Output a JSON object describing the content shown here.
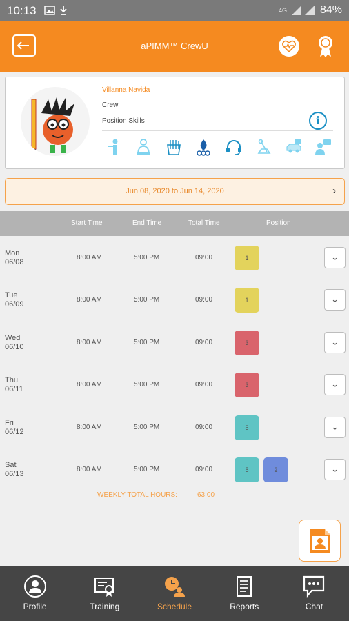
{
  "status_bar": {
    "time": "10:13",
    "network": "4G",
    "battery": "84%"
  },
  "app_bar": {
    "title": "aPIMM™ CrewU"
  },
  "profile": {
    "name": "Villanna Navida",
    "role": "Crew",
    "skills_label": "Position Skills",
    "skill_icons": [
      "host-icon",
      "cashier-icon",
      "fry-station-icon",
      "grill-icon",
      "headset-icon",
      "cleaning-icon",
      "drive-thru-icon",
      "presenter-icon"
    ]
  },
  "date_range": {
    "label": "Jun 08, 2020 to Jun 14, 2020"
  },
  "table": {
    "headers": {
      "start": "Start Time",
      "end": "End Time",
      "total": "Total Time",
      "position": "Position"
    },
    "rows": [
      {
        "day": "Mon",
        "date": "06/08",
        "start": "8:00 AM",
        "end": "5:00 PM",
        "total": "09:00",
        "positions": [
          {
            "label": "1",
            "color": "#e3d35c"
          }
        ]
      },
      {
        "day": "Tue",
        "date": "06/09",
        "start": "8:00 AM",
        "end": "5:00 PM",
        "total": "09:00",
        "positions": [
          {
            "label": "1",
            "color": "#e3d35c"
          }
        ]
      },
      {
        "day": "Wed",
        "date": "06/10",
        "start": "8:00 AM",
        "end": "5:00 PM",
        "total": "09:00",
        "positions": [
          {
            "label": "3",
            "color": "#d9646c"
          }
        ]
      },
      {
        "day": "Thu",
        "date": "06/11",
        "start": "8:00 AM",
        "end": "5:00 PM",
        "total": "09:00",
        "positions": [
          {
            "label": "3",
            "color": "#d9646c"
          }
        ]
      },
      {
        "day": "Fri",
        "date": "06/12",
        "start": "8:00 AM",
        "end": "5:00 PM",
        "total": "09:00",
        "positions": [
          {
            "label": "5",
            "color": "#5fc4c4"
          }
        ]
      },
      {
        "day": "Sat",
        "date": "06/13",
        "start": "8:00 AM",
        "end": "5:00 PM",
        "total": "09:00",
        "positions": [
          {
            "label": "5",
            "color": "#5fc4c4"
          },
          {
            "label": "2",
            "color": "#6f8cdc"
          }
        ]
      }
    ]
  },
  "weekly_total": {
    "label": "WEEKLY TOTAL HOURS:",
    "value": "63:00"
  },
  "nav": {
    "items": [
      {
        "label": "Profile",
        "icon": "profile-icon",
        "active": false
      },
      {
        "label": "Training",
        "icon": "training-icon",
        "active": false
      },
      {
        "label": "Schedule",
        "icon": "schedule-icon",
        "active": true
      },
      {
        "label": "Reports",
        "icon": "reports-icon",
        "active": false
      },
      {
        "label": "Chat",
        "icon": "chat-icon",
        "active": false
      }
    ]
  },
  "colors": {
    "accent": "#f58a20",
    "accent_light": "#f5a24b",
    "skill_blue": "#1a8fc4"
  }
}
